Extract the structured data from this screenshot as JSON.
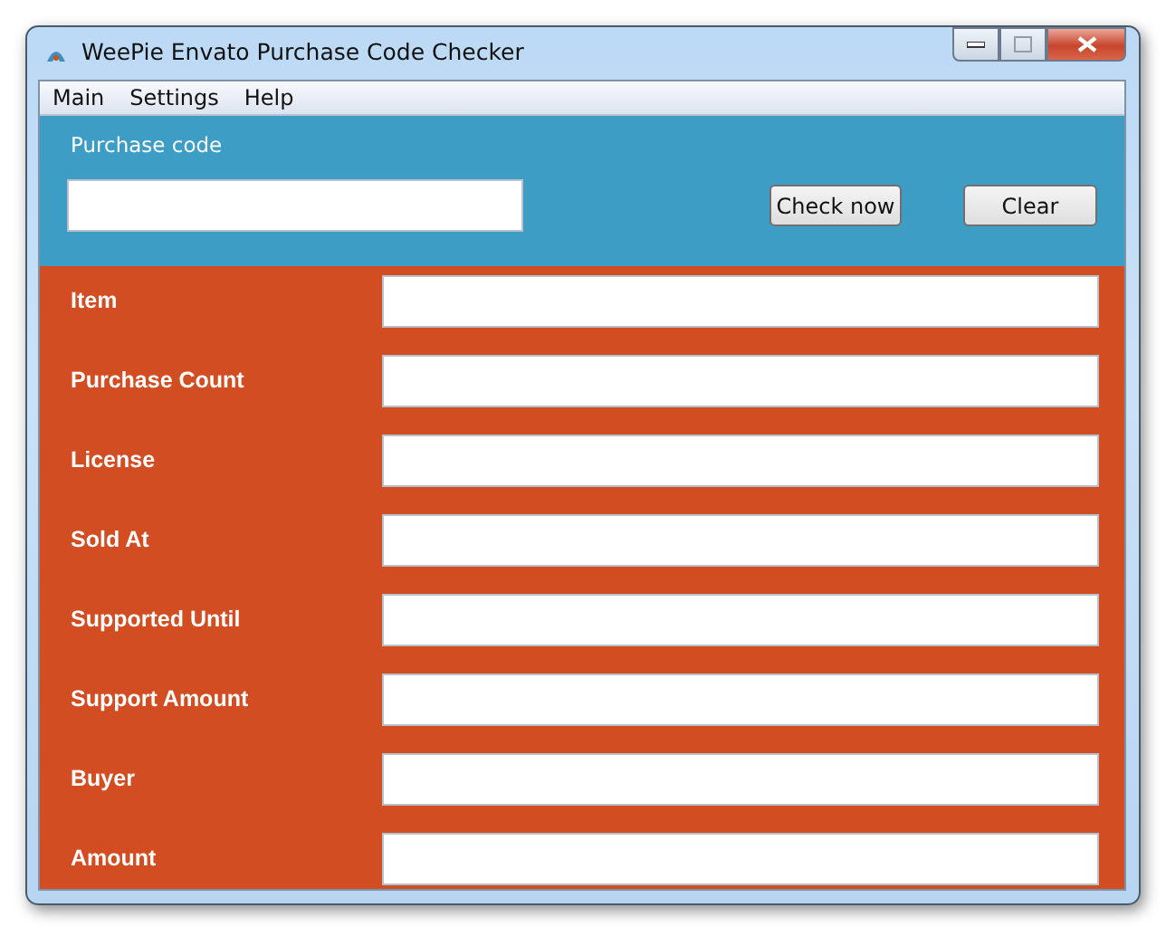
{
  "window": {
    "title": "WeePie Envato Purchase Code Checker"
  },
  "menu": [
    "Main",
    "Settings",
    "Help"
  ],
  "purchase_code": {
    "label": "Purchase code"
  },
  "buttons": [
    "Check now",
    "Clear"
  ],
  "fields": [
    {
      "label": "Item"
    },
    {
      "label": "Purchase Count"
    },
    {
      "label": "License"
    },
    {
      "label": "Sold At"
    },
    {
      "label": "Supported Until"
    },
    {
      "label": "Support Amount"
    },
    {
      "label": "Buyer"
    },
    {
      "label": "Amount"
    }
  ]
}
